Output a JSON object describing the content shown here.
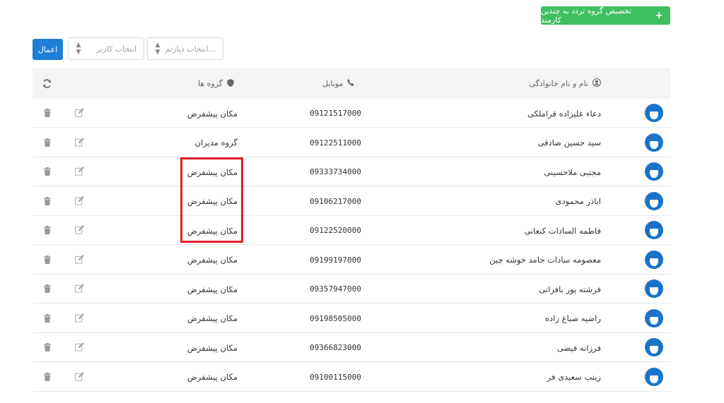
{
  "toolbar": {
    "assign_button": "تخصیص گروه تردد به چندین کارمند",
    "apply_button": "اعمال",
    "select_user_placeholder": "انتخاب کاربر",
    "select_department_placeholder": "انتخاب دپارتم..."
  },
  "table": {
    "headers": {
      "name": "نام و نام خانوادگی",
      "mobile": "موبایل",
      "groups": "گروه ها"
    },
    "rows": [
      {
        "name": "دعاء علیزاده قراملکی",
        "mobile": "09121517000",
        "group": "مکان پیشفرض"
      },
      {
        "name": "سید حسین صادقی",
        "mobile": "09122511000",
        "group": "گروه مدیران"
      },
      {
        "name": "مجتبی ملاحسینی",
        "mobile": "09333734000",
        "group": "مکان پیشفرض"
      },
      {
        "name": "اباذر محمودی",
        "mobile": "09106217000",
        "group": "مکان پیشفرض"
      },
      {
        "name": "فاطمه السادات کنعانی",
        "mobile": "09122520000",
        "group": "مکان پیشفرض"
      },
      {
        "name": "معصومه سادات حامد خوشه چین",
        "mobile": "09199197000",
        "group": "مکان پیشفرض"
      },
      {
        "name": "فرشته پور بافرانی",
        "mobile": "09357947000",
        "group": "مکان پیشفرض"
      },
      {
        "name": "راضیه صباغ زاده",
        "mobile": "09198505000",
        "group": "مکان پیشفرض"
      },
      {
        "name": "فرزانه فیضی",
        "mobile": "09366823000",
        "group": "مکان پیشفرض"
      },
      {
        "name": "زینب سعیدی فر",
        "mobile": "09100115000",
        "group": "مکان پیشفرض"
      }
    ]
  },
  "colors": {
    "assign_button": "#3fbf5f",
    "apply_button": "#1f7fd6",
    "avatar": "#1a73c9",
    "highlight": "#e0202a"
  },
  "icons": {
    "name_header": "user-circle-icon",
    "mobile_header": "phone-icon",
    "groups_header": "shield-icon",
    "refresh": "refresh-icon",
    "edit": "edit-icon",
    "delete": "trash-icon"
  }
}
